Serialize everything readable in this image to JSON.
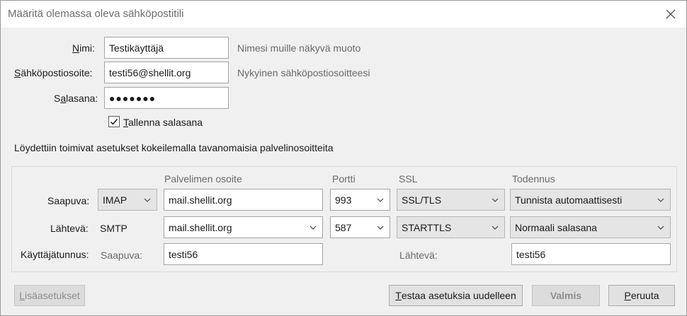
{
  "window": {
    "title": "Määritä olemassa oleva sähköpostitili"
  },
  "form": {
    "name": {
      "label_accel": "N",
      "label_rest": "imi:",
      "value": "Testikäyttäjä",
      "hint": "Nimesi muille näkyvä muoto"
    },
    "email": {
      "label_accel": "S",
      "label_rest": "ähköpostiosoite:",
      "value": "testi56@shellit.org",
      "hint": "Nykyinen sähköpostiosoitteesi"
    },
    "password": {
      "label_pre": "S",
      "label_accel": "a",
      "label_rest": "lasana:",
      "value": "●●●●●●●"
    },
    "remember": {
      "checked": true,
      "label_accel": "T",
      "label_rest": "allenna salasana"
    }
  },
  "status_text": "Löydettiin toimivat asetukset kokeilemalla tavanomaisia palvelinosoitteita",
  "server": {
    "headers": {
      "address": "Palvelimen osoite",
      "port": "Portti",
      "ssl": "SSL",
      "auth": "Todennus"
    },
    "incoming": {
      "label": "Saapuva:",
      "protocol": "IMAP",
      "host": "mail.shellit.org",
      "port": "993",
      "ssl": "SSL/TLS",
      "auth": "Tunnista automaattisesti"
    },
    "outgoing": {
      "label": "Lähtevä:",
      "protocol": "SMTP",
      "host": "mail.shellit.org",
      "port": "587",
      "ssl": "STARTTLS",
      "auth": "Normaali salasana"
    },
    "username": {
      "label": "Käyttäjätunnus:",
      "incoming_label": "Saapuva:",
      "incoming_value": "testi56",
      "outgoing_label": "Lähtevä:",
      "outgoing_value": "testi56"
    }
  },
  "buttons": {
    "advanced": {
      "accel": "L",
      "rest": "isäasetukset"
    },
    "retest": {
      "accel": "T",
      "rest": "estaa asetuksia uudelleen"
    },
    "done": {
      "label": "Valmis"
    },
    "cancel": {
      "accel": "P",
      "rest": "eruuta"
    }
  },
  "icons": {
    "close": "close-icon",
    "chevron": "chevron-down-icon",
    "check": "checkmark-icon"
  }
}
